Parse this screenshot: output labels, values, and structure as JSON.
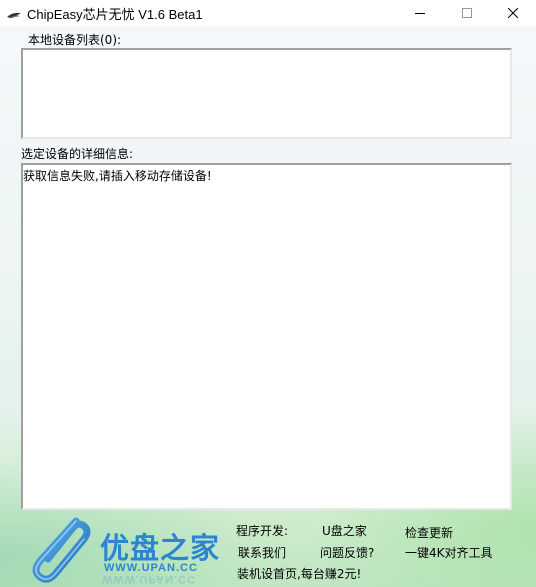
{
  "window": {
    "title": "ChipEasy芯片无忧 V1.6 Beta1"
  },
  "labels": {
    "device_list": "本地设备列表(0):",
    "device_details": "选定设备的详细信息:"
  },
  "details_text": "获取信息失败,请插入移动存储设备!",
  "logo": {
    "text": "优盘之家",
    "url": "WWW.UPAN.CC"
  },
  "footer_links": {
    "developer": "程序开发:",
    "upan_home": "U盘之家",
    "check_update": "检查更新",
    "contact_us": "联系我们",
    "feedback": "问题反馈?",
    "align_tool": "一键4K对齐工具",
    "install_promo": "装机设首页,每台赚2元!"
  },
  "colors": {
    "logo_blue": "#2b86cf",
    "bg_green": "#cfeccd"
  }
}
